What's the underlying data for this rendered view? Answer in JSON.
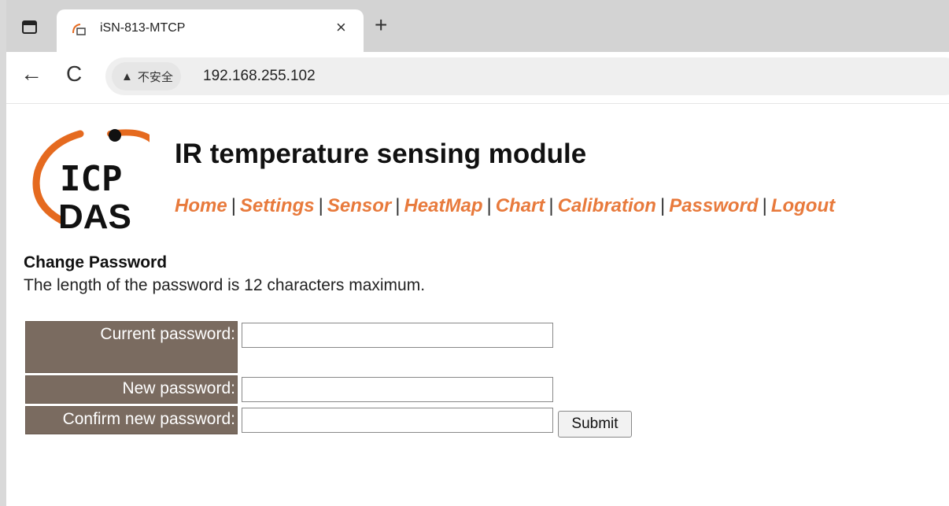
{
  "browser": {
    "tab_title": "iSN-813-MTCP",
    "tab_close": "×",
    "new_tab": "+",
    "nav_back": "←",
    "nav_reload": "C",
    "security_label": "不安全",
    "url": "192.168.255.102"
  },
  "header": {
    "logo_text_line1": "ICP",
    "logo_text_line2": "DAS",
    "title": "IR temperature sensing module"
  },
  "nav": {
    "items": [
      {
        "label": "Home"
      },
      {
        "label": "Settings"
      },
      {
        "label": "Sensor"
      },
      {
        "label": "HeatMap"
      },
      {
        "label": "Chart"
      },
      {
        "label": "Calibration"
      },
      {
        "label": "Password"
      },
      {
        "label": "Logout"
      }
    ],
    "separator": "|"
  },
  "password_form": {
    "title": "Change Password",
    "note": "The length of the password is 12 characters maximum.",
    "fields": [
      {
        "label": "Current password:",
        "value": ""
      },
      {
        "label": "New password:",
        "value": ""
      },
      {
        "label": "Confirm new password:",
        "value": ""
      }
    ],
    "submit_label": "Submit"
  },
  "colors": {
    "nav_link": "#e87a3c",
    "label_bg": "#7a6b60",
    "logo_orange": "#e56a1f"
  }
}
